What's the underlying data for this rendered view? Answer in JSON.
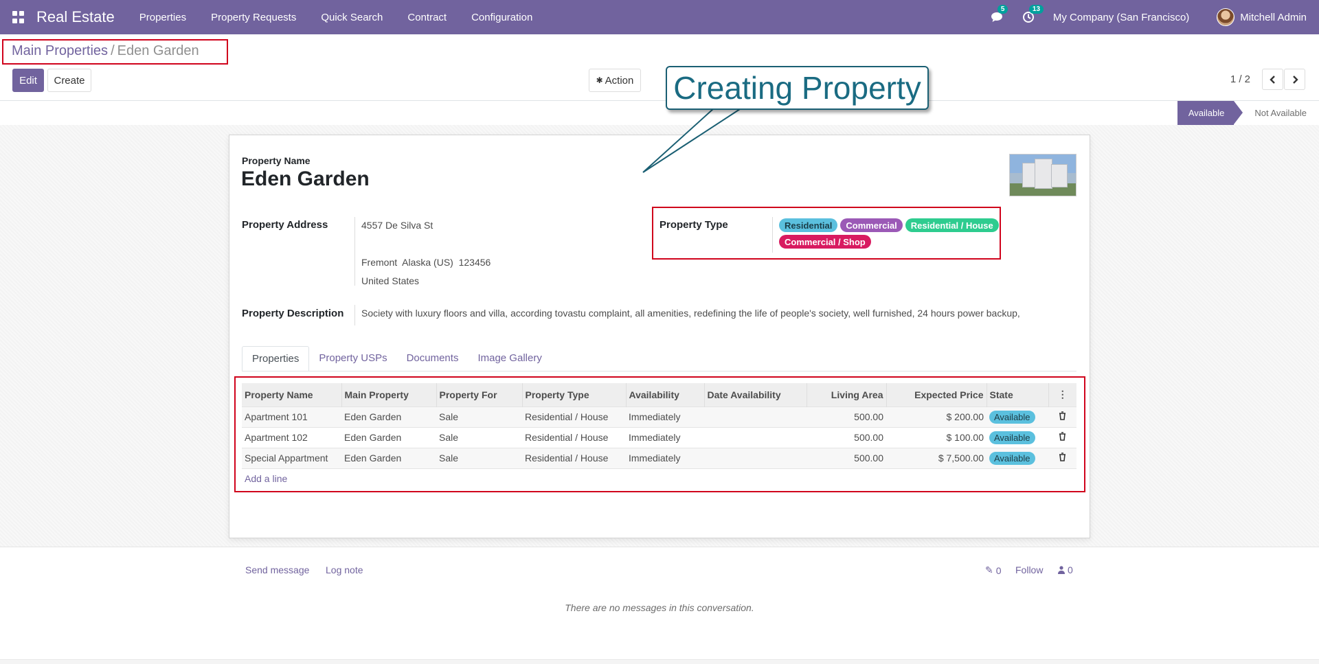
{
  "navbar": {
    "app_name": "Real Estate",
    "menu": [
      "Properties",
      "Property Requests",
      "Quick Search",
      "Contract",
      "Configuration"
    ],
    "messages_count": "5",
    "activities_count": "13",
    "company": "My Company (San Francisco)",
    "user": "Mitchell Admin",
    "color": "#71639e"
  },
  "breadcrumb": {
    "parent": "Main Properties",
    "separator": "/",
    "current": "Eden Garden"
  },
  "toolbar": {
    "edit_label": "Edit",
    "create_label": "Create",
    "action_label": "Action",
    "pager": "1 / 2"
  },
  "callout": {
    "text": "Creating Property"
  },
  "status": {
    "stages": [
      "Available",
      "Not Available"
    ],
    "active": "Available"
  },
  "form": {
    "name_label": "Property Name",
    "name": "Eden Garden",
    "address_label": "Property Address",
    "address": {
      "street": "4557 De Silva St",
      "city_line": "Fremont  Alaska (US)  123456",
      "country": "United States"
    },
    "type_label": "Property Type",
    "types": [
      {
        "label": "Residential",
        "bg": "#5bc0de",
        "fg": "#1a3d48"
      },
      {
        "label": "Commercial",
        "bg": "#9b59b6",
        "fg": "#ffffff"
      },
      {
        "label": "Residential / House",
        "bg": "#2ecc8f",
        "fg": "#ffffff"
      },
      {
        "label": "Commercial / Shop",
        "bg": "#d81b60",
        "fg": "#ffffff"
      }
    ],
    "description_label": "Property Description",
    "description": "Society with luxury floors and villa, according tovastu complaint, all amenities, redefining the life of people's society, well furnished, 24 hours power backup,"
  },
  "tabs": [
    "Properties",
    "Property USPs",
    "Documents",
    "Image Gallery"
  ],
  "table": {
    "columns": [
      "Property Name",
      "Main Property",
      "Property For",
      "Property Type",
      "Availability",
      "Date Availability",
      "Living Area",
      "Expected Price",
      "State"
    ],
    "rows": [
      {
        "name": "Apartment 101",
        "main": "Eden Garden",
        "for": "Sale",
        "type": "Residential / House",
        "availability": "Immediately",
        "date": "",
        "area": "500.00",
        "price": "$ 200.00",
        "state": "Available"
      },
      {
        "name": "Apartment 102",
        "main": "Eden Garden",
        "for": "Sale",
        "type": "Residential / House",
        "availability": "Immediately",
        "date": "",
        "area": "500.00",
        "price": "$ 100.00",
        "state": "Available"
      },
      {
        "name": "Special Appartment",
        "main": "Eden Garden",
        "for": "Sale",
        "type": "Residential / House",
        "availability": "Immediately",
        "date": "",
        "area": "500.00",
        "price": "$ 7,500.00",
        "state": "Available"
      }
    ],
    "add_line": "Add a line"
  },
  "chatter": {
    "send_message": "Send message",
    "log_note": "Log note",
    "attachments": "0",
    "follow": "Follow",
    "followers": "0",
    "empty": "There are no messages in this conversation."
  }
}
